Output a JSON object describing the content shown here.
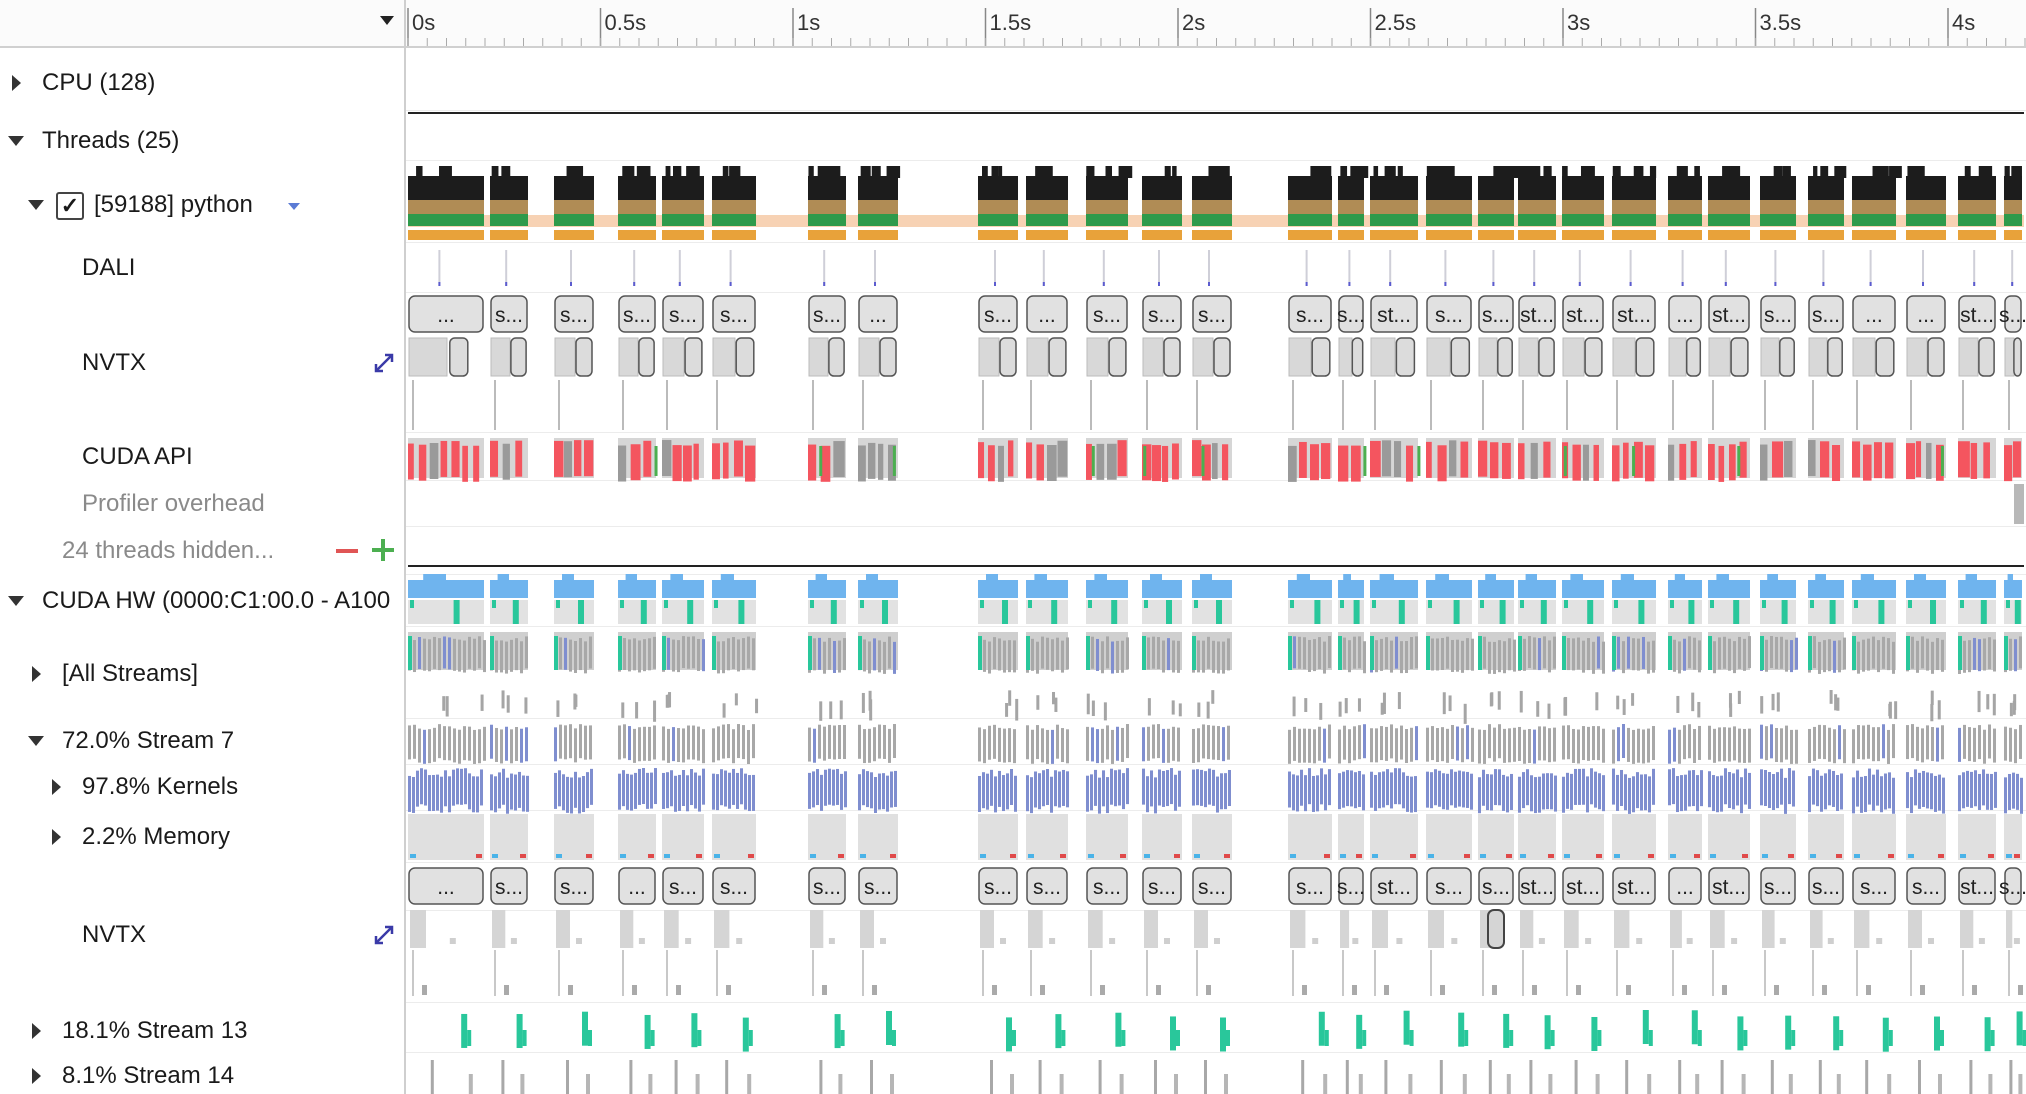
{
  "ruler": {
    "ticks": [
      "0s",
      "0.5s",
      "1s",
      "1.5s",
      "2s",
      "2.5s",
      "3s",
      "3.5s",
      "4s"
    ]
  },
  "rows": {
    "cpu": "CPU (128)",
    "threads": "Threads (25)",
    "python": "[59188] python",
    "python_checked": "✓",
    "dali": "DALI",
    "nvtx": "NVTX",
    "cuda_api": "CUDA API",
    "profiler_overhead": "Profiler overhead",
    "threads_hidden": "24 threads hidden...",
    "cuda_hw": "CUDA HW (0000:C1:00.0 - A100",
    "all_streams": "[All Streams]",
    "stream7": "72.0% Stream 7",
    "kernels": "97.8% Kernels",
    "memory": "2.2% Memory",
    "nvtx2": "NVTX",
    "stream13": "18.1% Stream 13",
    "stream14": "8.1% Stream 14"
  },
  "nvtx_row1_labels": [
    "...",
    "s...",
    "s...",
    "s...",
    "s...",
    "s...",
    "s...",
    "...",
    "s...",
    "...",
    "s...",
    "s...",
    "s...",
    "s...",
    "s...",
    "st...",
    "s...",
    "s...",
    "st...",
    "st...",
    "st...",
    "...",
    "st...",
    "s...",
    "s...",
    "...",
    "...",
    "st...",
    "s..."
  ],
  "nvtx_row2_labels": [
    "...",
    "s...",
    "s...",
    "...",
    "s...",
    "s...",
    "s...",
    "s...",
    "s...",
    "s...",
    "s...",
    "s...",
    "s...",
    "s...",
    "s...",
    "st...",
    "s...",
    "s...",
    "st...",
    "st...",
    "st...",
    "...",
    "st...",
    "s...",
    "s...",
    "s...",
    "s...",
    "st...",
    "s..."
  ],
  "colors": {
    "cpu_black": "#1c1c1c",
    "thread_brown": "#b08c55",
    "thread_green": "#2e9a4b",
    "thread_orange": "#e8a23a",
    "thread_idle": "#f7d2b4",
    "cuda_red": "#f4555f",
    "kernel_blue": "#7f8ecf",
    "hw_blue": "#6fb4ee",
    "hw_teal": "#29c79b",
    "bar_gray": "#a8a8a8",
    "box_gray": "#e1e1e1"
  }
}
